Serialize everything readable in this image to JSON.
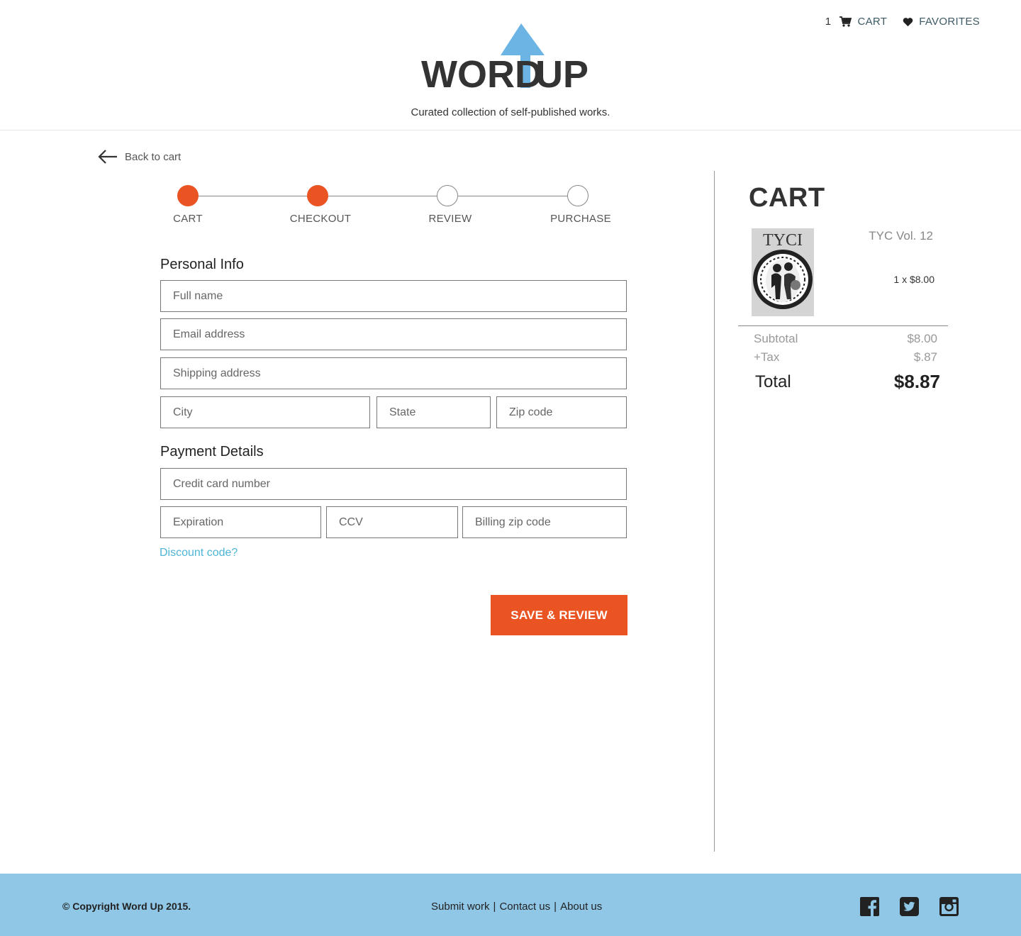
{
  "header": {
    "cart_count": "1",
    "cart_label": "CART",
    "favorites_label": "FAVORITES",
    "logo_text": "WORD UP",
    "tagline": "Curated collection of self-published works."
  },
  "back_link": "Back to cart",
  "steps": [
    {
      "label": "CART",
      "status": "complete"
    },
    {
      "label": "CHECKOUT",
      "status": "complete"
    },
    {
      "label": "REVIEW",
      "status": "incomplete"
    },
    {
      "label": "PURCHASE",
      "status": "incomplete"
    }
  ],
  "personal_info": {
    "title": "Personal Info",
    "full_name": "Full name",
    "email": "Email address",
    "shipping": "Shipping address",
    "city": "City",
    "state": "State",
    "zip": "Zip code"
  },
  "payment": {
    "title": "Payment Details",
    "card": "Credit card number",
    "expiration": "Expiration",
    "ccv": "CCV",
    "billing_zip": "Billing zip code",
    "discount_link": "Discount code?"
  },
  "save_button": "SAVE & REVIEW",
  "cart": {
    "title": "CART",
    "item_title": "TYC Vol. 12",
    "item_qty": "1 x $8.00",
    "cover_text": "TYCI",
    "subtotal_label": "Subtotal",
    "subtotal_value": "$8.00",
    "tax_label": "+Tax",
    "tax_value": "$.87",
    "total_label": "Total",
    "total_value": "$8.87"
  },
  "footer": {
    "copyright": "© Copyright Word Up 2015.",
    "submit": "Submit work",
    "contact": "Contact us",
    "about": "About us",
    "sep": "|"
  },
  "colors": {
    "accent": "#ea5423",
    "brand_blue": "#6cb4e4",
    "footer_bg": "#90c7e7",
    "link": "#4db5d6"
  }
}
